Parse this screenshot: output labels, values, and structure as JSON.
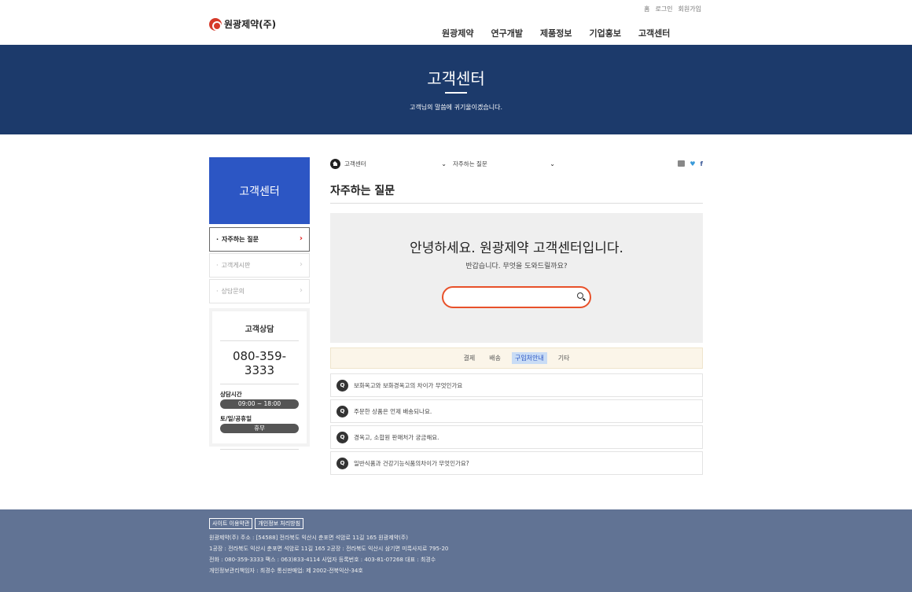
{
  "header": {
    "util": [
      "홈",
      "로그인",
      "회원가입"
    ],
    "logo_text": "원광제약(주)",
    "nav": [
      "원광제약",
      "연구개발",
      "제품정보",
      "기업홍보",
      "고객센터"
    ]
  },
  "visual": {
    "title": "고객센터",
    "subtitle": "고객님의 말씀에 귀기울이겠습니다."
  },
  "lnb": {
    "title": "고객센터",
    "items": [
      {
        "label": "자주하는 질문",
        "active": true
      },
      {
        "label": "고객게시판",
        "active": false
      },
      {
        "label": "상담문의",
        "active": false
      }
    ],
    "cs": {
      "title": "고객상담",
      "phone": "080-359-3333",
      "hours_label": "상담시간",
      "hours_value": "09:00 ~ 18:00",
      "holiday_label": "토/일/공휴일",
      "holiday_value": "휴무"
    }
  },
  "location": {
    "sel1": "고객센터",
    "sel2": "자주하는 질문"
  },
  "main": {
    "title": "자주하는 질문",
    "search": {
      "headline": "안녕하세요. 원광제약 고객센터입니다.",
      "sub": "반갑습니다. 무엇을 도와드릴까요?",
      "placeholder": ""
    },
    "tabs": [
      {
        "label": "결제",
        "active": false
      },
      {
        "label": "배송",
        "active": false
      },
      {
        "label": "구입처안내",
        "active": true
      },
      {
        "label": "기타",
        "active": false
      }
    ],
    "faqs": [
      {
        "q": "Q",
        "text": "보화옥고와 보화경옥고의 차이가 무엇인가요"
      },
      {
        "q": "Q",
        "text": "주문한 상품은 언제 배송되나요."
      },
      {
        "q": "Q",
        "text": "경옥고, 소합원 판매처가 궁금해요."
      },
      {
        "q": "Q",
        "text": "일반식품과 건강기능식품의차이가 무엇인가요?"
      }
    ]
  },
  "footer": {
    "links": [
      "사이트 이용약관",
      "개인정보 처리방침"
    ],
    "lines": [
      "원광제약(주)    주소 : [54588] 전라북도 익산시 춘포면 석암로 11길 165 원광제약(주)",
      "1공장 : 전라북도 익산시 춘포면 석암로 11길 165    2공장 : 전라북도 익산시 삼기면 미륵사지로 795-20",
      "전화 : 080-359-3333    팩스 : 063)833-4114    사업자 등록번호 : 403-81-07268    대표 : 최경수",
      "개인정보관리책임자 : 최경수    통신판매업: 제 2002-전북익산-34호"
    ]
  },
  "colors": {
    "visual_bg": "#1c3a6b",
    "lnb_title_bg": "#2c56c4",
    "search_border": "#e8512a",
    "footer_bg": "#617394"
  }
}
